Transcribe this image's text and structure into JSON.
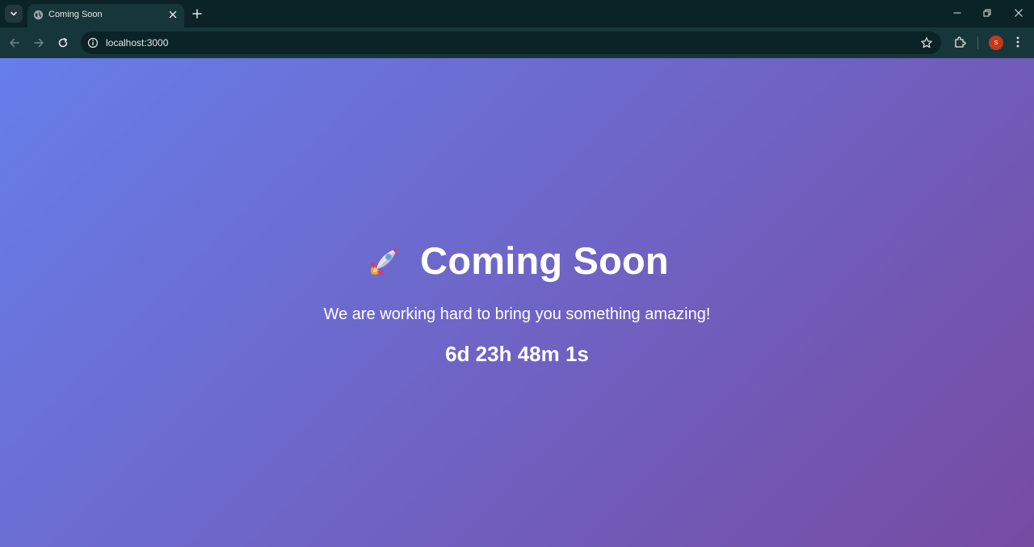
{
  "browser": {
    "tab": {
      "title": "Coming Soon"
    },
    "address": {
      "url": "localhost:3000"
    },
    "profile": {
      "initial": "S",
      "color": "#c4381c"
    }
  },
  "page": {
    "icon": "rocket-icon",
    "title": "Coming Soon",
    "subtitle": "We are working hard to bring you something amazing!",
    "countdown": "6d 23h 48m 1s",
    "background": {
      "from": "#667eea",
      "to": "#764ba2"
    }
  }
}
